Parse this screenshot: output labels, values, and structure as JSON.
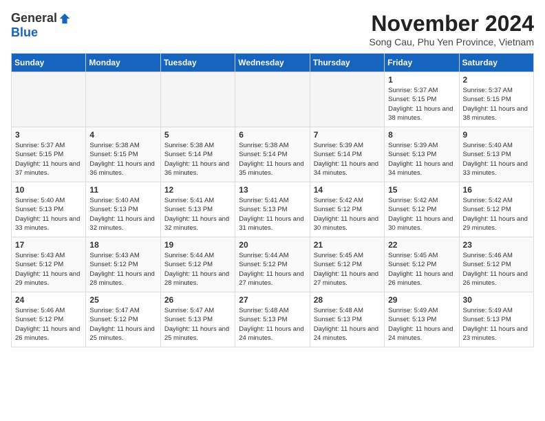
{
  "header": {
    "logo_general": "General",
    "logo_blue": "Blue",
    "title": "November 2024",
    "subtitle": "Song Cau, Phu Yen Province, Vietnam"
  },
  "weekdays": [
    "Sunday",
    "Monday",
    "Tuesday",
    "Wednesday",
    "Thursday",
    "Friday",
    "Saturday"
  ],
  "weeks": [
    [
      {
        "day": "",
        "info": ""
      },
      {
        "day": "",
        "info": ""
      },
      {
        "day": "",
        "info": ""
      },
      {
        "day": "",
        "info": ""
      },
      {
        "day": "",
        "info": ""
      },
      {
        "day": "1",
        "info": "Sunrise: 5:37 AM\nSunset: 5:15 PM\nDaylight: 11 hours and 38 minutes."
      },
      {
        "day": "2",
        "info": "Sunrise: 5:37 AM\nSunset: 5:15 PM\nDaylight: 11 hours and 38 minutes."
      }
    ],
    [
      {
        "day": "3",
        "info": "Sunrise: 5:37 AM\nSunset: 5:15 PM\nDaylight: 11 hours and 37 minutes."
      },
      {
        "day": "4",
        "info": "Sunrise: 5:38 AM\nSunset: 5:15 PM\nDaylight: 11 hours and 36 minutes."
      },
      {
        "day": "5",
        "info": "Sunrise: 5:38 AM\nSunset: 5:14 PM\nDaylight: 11 hours and 36 minutes."
      },
      {
        "day": "6",
        "info": "Sunrise: 5:38 AM\nSunset: 5:14 PM\nDaylight: 11 hours and 35 minutes."
      },
      {
        "day": "7",
        "info": "Sunrise: 5:39 AM\nSunset: 5:14 PM\nDaylight: 11 hours and 34 minutes."
      },
      {
        "day": "8",
        "info": "Sunrise: 5:39 AM\nSunset: 5:13 PM\nDaylight: 11 hours and 34 minutes."
      },
      {
        "day": "9",
        "info": "Sunrise: 5:40 AM\nSunset: 5:13 PM\nDaylight: 11 hours and 33 minutes."
      }
    ],
    [
      {
        "day": "10",
        "info": "Sunrise: 5:40 AM\nSunset: 5:13 PM\nDaylight: 11 hours and 33 minutes."
      },
      {
        "day": "11",
        "info": "Sunrise: 5:40 AM\nSunset: 5:13 PM\nDaylight: 11 hours and 32 minutes."
      },
      {
        "day": "12",
        "info": "Sunrise: 5:41 AM\nSunset: 5:13 PM\nDaylight: 11 hours and 32 minutes."
      },
      {
        "day": "13",
        "info": "Sunrise: 5:41 AM\nSunset: 5:13 PM\nDaylight: 11 hours and 31 minutes."
      },
      {
        "day": "14",
        "info": "Sunrise: 5:42 AM\nSunset: 5:12 PM\nDaylight: 11 hours and 30 minutes."
      },
      {
        "day": "15",
        "info": "Sunrise: 5:42 AM\nSunset: 5:12 PM\nDaylight: 11 hours and 30 minutes."
      },
      {
        "day": "16",
        "info": "Sunrise: 5:42 AM\nSunset: 5:12 PM\nDaylight: 11 hours and 29 minutes."
      }
    ],
    [
      {
        "day": "17",
        "info": "Sunrise: 5:43 AM\nSunset: 5:12 PM\nDaylight: 11 hours and 29 minutes."
      },
      {
        "day": "18",
        "info": "Sunrise: 5:43 AM\nSunset: 5:12 PM\nDaylight: 11 hours and 28 minutes."
      },
      {
        "day": "19",
        "info": "Sunrise: 5:44 AM\nSunset: 5:12 PM\nDaylight: 11 hours and 28 minutes."
      },
      {
        "day": "20",
        "info": "Sunrise: 5:44 AM\nSunset: 5:12 PM\nDaylight: 11 hours and 27 minutes."
      },
      {
        "day": "21",
        "info": "Sunrise: 5:45 AM\nSunset: 5:12 PM\nDaylight: 11 hours and 27 minutes."
      },
      {
        "day": "22",
        "info": "Sunrise: 5:45 AM\nSunset: 5:12 PM\nDaylight: 11 hours and 26 minutes."
      },
      {
        "day": "23",
        "info": "Sunrise: 5:46 AM\nSunset: 5:12 PM\nDaylight: 11 hours and 26 minutes."
      }
    ],
    [
      {
        "day": "24",
        "info": "Sunrise: 5:46 AM\nSunset: 5:12 PM\nDaylight: 11 hours and 26 minutes."
      },
      {
        "day": "25",
        "info": "Sunrise: 5:47 AM\nSunset: 5:12 PM\nDaylight: 11 hours and 25 minutes."
      },
      {
        "day": "26",
        "info": "Sunrise: 5:47 AM\nSunset: 5:13 PM\nDaylight: 11 hours and 25 minutes."
      },
      {
        "day": "27",
        "info": "Sunrise: 5:48 AM\nSunset: 5:13 PM\nDaylight: 11 hours and 24 minutes."
      },
      {
        "day": "28",
        "info": "Sunrise: 5:48 AM\nSunset: 5:13 PM\nDaylight: 11 hours and 24 minutes."
      },
      {
        "day": "29",
        "info": "Sunrise: 5:49 AM\nSunset: 5:13 PM\nDaylight: 11 hours and 24 minutes."
      },
      {
        "day": "30",
        "info": "Sunrise: 5:49 AM\nSunset: 5:13 PM\nDaylight: 11 hours and 23 minutes."
      }
    ]
  ]
}
